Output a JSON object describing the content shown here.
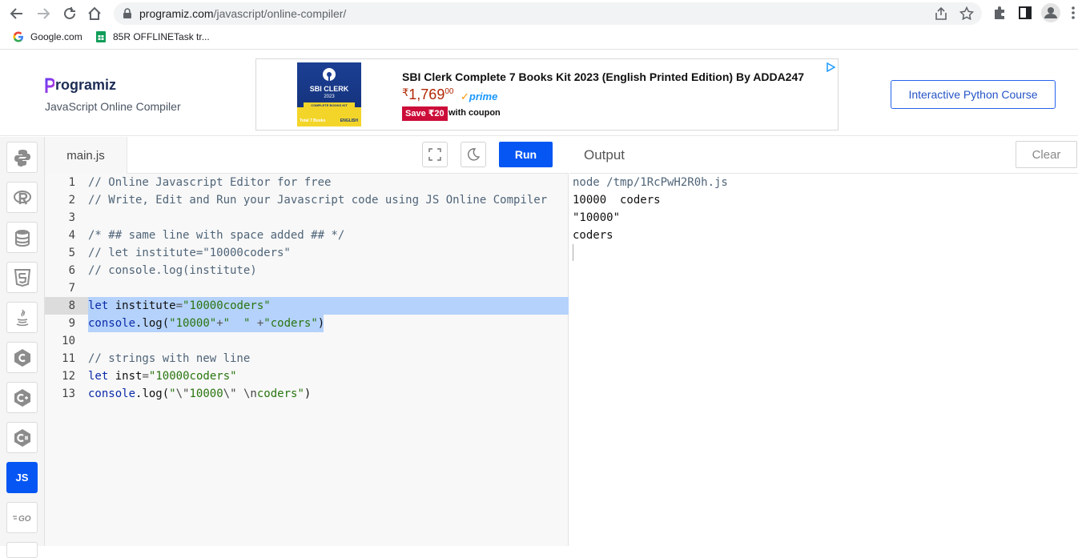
{
  "browser": {
    "url_host": "programiz.com",
    "url_path": "/javascript/online-compiler/",
    "bookmarks": [
      "Google.com",
      "85R OFFLINETask tr..."
    ]
  },
  "header": {
    "logo": "rogramiz",
    "subtitle": "JavaScript Online Compiler",
    "cta_label": "Interactive Python Course"
  },
  "ad": {
    "image_title": "SBI CLERK",
    "image_year": "2023",
    "image_band": "COMPLETE BOOKS KIT",
    "image_bottom_left": "Total 7 Books",
    "image_bottom_right": "ENGLISH",
    "title": "SBI Clerk Complete 7 Books Kit 2023 (English Printed Edition) By ADDA247",
    "price_symbol": "₹",
    "price_whole": "1,769",
    "price_fraction": "00",
    "prime": "prime",
    "save": "Save ₹20",
    "coupon": "with coupon"
  },
  "sidebar": {
    "languages": [
      "python",
      "r",
      "sql",
      "html",
      "java",
      "c",
      "cplusplus",
      "csharp",
      "javascript",
      "go"
    ],
    "active_label": "JS"
  },
  "editor": {
    "file_tab": "main.js",
    "run_label": "Run",
    "lines": [
      "// Online Javascript Editor for free",
      "// Write, Edit and Run your Javascript code using JS Online Compiler",
      "",
      "/* ## same line with space added ## */",
      "// let institute=\"10000coders\"",
      "// console.log(institute)",
      "",
      "let institute=\"10000coders\"",
      "console.log(\"10000\"+\"  \" +\"coders\")",
      "",
      "// strings with new line",
      "let inst=\"10000coders\"",
      "console.log(\"\\\"10000\\\" \\ncoders\")"
    ]
  },
  "output": {
    "title": "Output",
    "clear_label": "Clear",
    "lines": [
      "node /tmp/1RcPwH2R0h.js",
      "10000  coders",
      "\"10000\"",
      "coders"
    ]
  },
  "colors": {
    "accent": "#0556f3",
    "selection": "#b5d2fc",
    "comment": "#4f6478",
    "keyword": "#0a2aa8",
    "string": "#29750f"
  }
}
